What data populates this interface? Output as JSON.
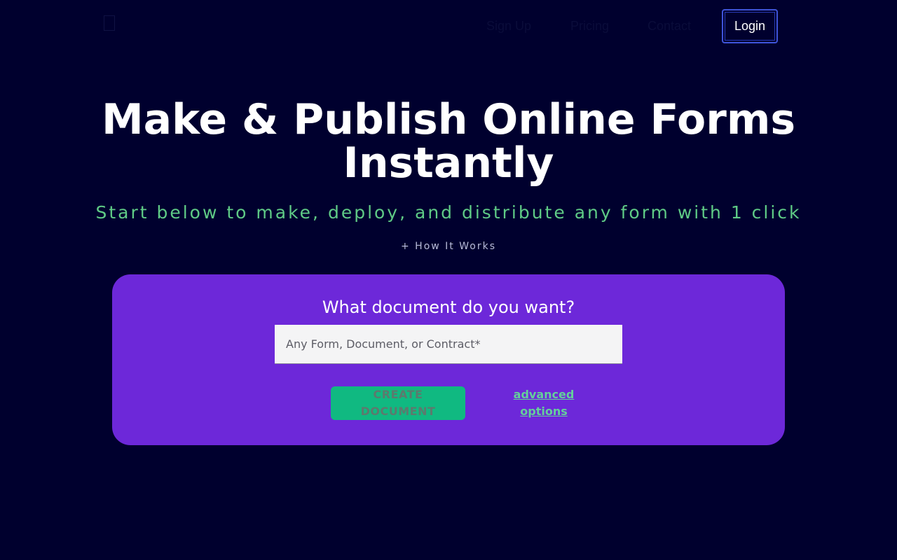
{
  "nav": {
    "logo_icon": "document-icon",
    "links": {
      "signup": "Sign Up",
      "pricing": "Pricing",
      "contact": "Contact"
    },
    "login_label": "Login"
  },
  "hero": {
    "title": "Make & Publish Online Forms Instantly",
    "subtitle": "Start below to make, deploy, and distribute any form with 1 click",
    "how_it_works": "+ How It Works"
  },
  "card": {
    "title": "What document do you want?",
    "input_placeholder": "Any Form, Document, or Contract*",
    "input_value": "",
    "create_label": "CREATE DOCUMENT",
    "advanced_label": "advanced options"
  },
  "colors": {
    "background": "#00002e",
    "card": "#6d28d9",
    "accent_green": "#10b981",
    "subtitle_green": "#5fcb86",
    "login_border": "#3f54d8"
  }
}
